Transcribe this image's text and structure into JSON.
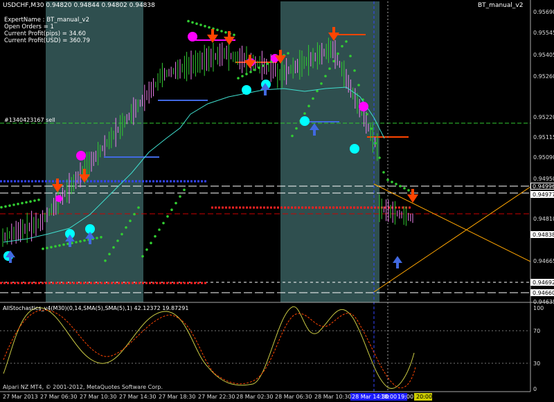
{
  "header": {
    "symbol_line": "USDCHF,M30  0.94820 0.94844 0.94802 0.94838",
    "indicator_name": "BT_manual_v2"
  },
  "info_panel": {
    "expert": "ExpertName : BT_manual_v2",
    "orders": "Open Orders = 1",
    "pips": "Current Profit(pips) = 34.60",
    "usd": "Current Profit(USD) = 360.79"
  },
  "order_label": "#1340423167 sell",
  "price_axis": {
    "ticks": [
      "0.95690",
      "0.95545",
      "0.95405",
      "0.95260",
      "0.95220",
      "0.95115",
      "0.95090",
      "0.94950",
      "0.94810",
      "0.94665",
      "0.94635"
    ],
    "boxes": [
      {
        "label": "0.94996",
        "color": "#ffffff",
        "bg": "#000000",
        "text": "#ffffff"
      },
      {
        "label": "0.94977",
        "color": "#ffffff",
        "bg": "#ffffff",
        "text": "#000000"
      },
      {
        "label": "0.94838",
        "color": "#ffffff",
        "bg": "#ffffff",
        "text": "#000000"
      },
      {
        "label": "0.94692",
        "color": "#ffffff",
        "bg": "#ffffff",
        "text": "#000000"
      },
      {
        "label": "0.94660",
        "color": "#ffffff",
        "bg": "#ffffff",
        "text": "#000000"
      }
    ]
  },
  "stoch_panel": {
    "title": "AllStochastics_v4(M30)(0,14,SMA(5),SMA(5),1) 42.12372 19.87291",
    "ticks": [
      "100",
      "70",
      "30",
      "0"
    ]
  },
  "time_axis": {
    "ticks": [
      "27 Mar 2013",
      "27 Mar 06:30",
      "27 Mar 10:30",
      "27 Mar 14:30",
      "27 Mar 18:30",
      "27 Mar 22:30",
      "28 Mar 02:30",
      "28 Mar 06:30",
      "28 Mar 10:30"
    ],
    "session_boxes": [
      "28 Mar 14:30",
      "18:00",
      "19:00",
      "20:00"
    ]
  },
  "copyright": "Alpari NZ MT4, © 2001-2012, MetaQuotes Software Corp.",
  "colors": {
    "background": "#000000",
    "session_band": "#2f4f4f",
    "bull_candle": "#32cd32",
    "bear_candle": "#ee82ee",
    "ma_line": "#40e0d0",
    "psar_dots": "#32cd32",
    "sell_arrow": "#ff4500",
    "buy_arrow": "#4169e1",
    "fractal_magenta": "#ff00ff",
    "fractal_cyan": "#00ffff",
    "stoch_main": "#cccc44",
    "stoch_signal": "#ff4500",
    "channel_lines": "#ffa500"
  }
}
